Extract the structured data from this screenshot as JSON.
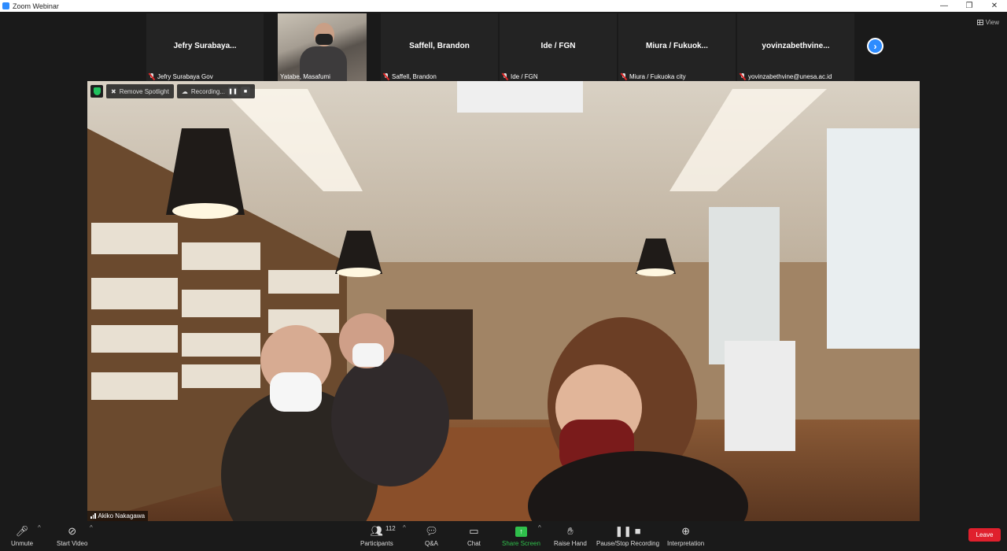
{
  "window": {
    "title": "Zoom Webinar",
    "minimize": "—",
    "restore": "❐",
    "close": "✕"
  },
  "view_button": {
    "label": "View"
  },
  "participants_strip": [
    {
      "display_name": "Jefry  Surabaya...",
      "label": "Jefry Surabaya Gov",
      "video": false
    },
    {
      "display_name": "",
      "label": "Yatabe, Masafumi",
      "video": true
    },
    {
      "display_name": "Saffell, Brandon",
      "label": "Saffell, Brandon",
      "video": false
    },
    {
      "display_name": "Ide / FGN",
      "label": "Ide / FGN",
      "video": false
    },
    {
      "display_name": "Miura / Fukuok...",
      "label": "Miura / Fukuoka city",
      "video": false
    },
    {
      "display_name": "yovinzabethvine...",
      "label": "yovinzabethvine@unesa.ac.id",
      "video": false
    }
  ],
  "next_page_icon": "chevron-right-icon",
  "spotlight": {
    "remove_label": "Remove Spotlight",
    "recording_label": "Recording...",
    "pause_glyph": "❚❚",
    "stop_glyph": "■",
    "speaker_name": "Akiko Nakagawa"
  },
  "toolbar": {
    "unmute": "Unmute",
    "start_video": "Start Video",
    "participants": "Participants",
    "participant_count": "112",
    "qa": "Q&A",
    "chat": "Chat",
    "share_screen": "Share Screen",
    "raise_hand": "Raise Hand",
    "pause_stop_recording": "Pause/Stop Recording",
    "interpretation": "Interpretation",
    "leave": "Leave"
  },
  "colors": {
    "accent": "#2d8cff",
    "share": "#2fbf4b",
    "leave": "#e0202d",
    "secure": "#21c25e"
  }
}
